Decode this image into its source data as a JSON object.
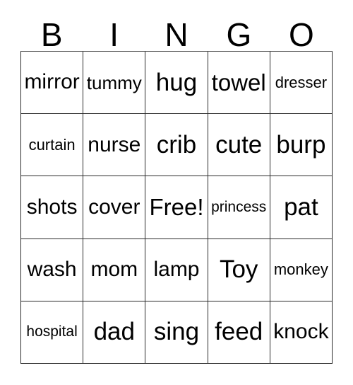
{
  "card": {
    "title": "Bingo Card",
    "header_letters": [
      "B",
      "I",
      "N",
      "G",
      "O"
    ],
    "free_space_label": "Free!",
    "colors": {
      "background": "#ffffff",
      "text": "#000000",
      "grid_line": "#2b2b2b"
    },
    "rows": [
      [
        {
          "text": "mirror",
          "size": "md"
        },
        {
          "text": "tummy",
          "size": "sm"
        },
        {
          "text": "hug",
          "size": "xl"
        },
        {
          "text": "towel",
          "size": "lg"
        },
        {
          "text": "dresser",
          "size": "xs"
        }
      ],
      [
        {
          "text": "curtain",
          "size": "xs"
        },
        {
          "text": "nurse",
          "size": "md"
        },
        {
          "text": "crib",
          "size": "xl"
        },
        {
          "text": "cute",
          "size": "xl"
        },
        {
          "text": "burp",
          "size": "xl"
        }
      ],
      [
        {
          "text": "shots",
          "size": "md"
        },
        {
          "text": "cover",
          "size": "md"
        },
        {
          "text": "Free!",
          "size": "lg"
        },
        {
          "text": "princess",
          "size": "xxs"
        },
        {
          "text": "pat",
          "size": "xl"
        }
      ],
      [
        {
          "text": "wash",
          "size": "md"
        },
        {
          "text": "mom",
          "size": "md"
        },
        {
          "text": "lamp",
          "size": "md"
        },
        {
          "text": "Toy",
          "size": "xl"
        },
        {
          "text": "monkey",
          "size": "xs"
        }
      ],
      [
        {
          "text": "hospital",
          "size": "xxs"
        },
        {
          "text": "dad",
          "size": "xl"
        },
        {
          "text": "sing",
          "size": "xl"
        },
        {
          "text": "feed",
          "size": "xl"
        },
        {
          "text": "knock",
          "size": "md"
        }
      ]
    ]
  }
}
